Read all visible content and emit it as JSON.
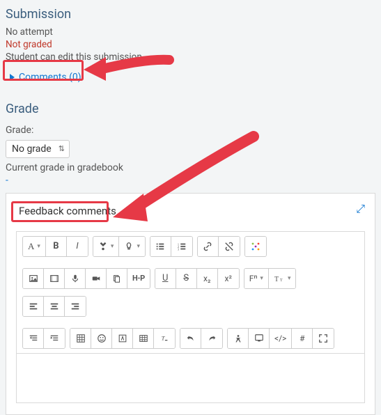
{
  "submission": {
    "heading": "Submission",
    "status_attempt": "No attempt",
    "status_graded": "Not graded",
    "status_edit": "Student can edit this submission",
    "comments_label": "Comments (0)"
  },
  "grade": {
    "heading": "Grade",
    "label": "Grade:",
    "selected": "No grade",
    "hint": "Current grade in gradebook",
    "dash": "-"
  },
  "feedback": {
    "title": "Feedback comments",
    "expand_icon": "⤢"
  },
  "toolbar": {
    "para": "A",
    "bold": "B",
    "italic": "I",
    "h5p": "H-P",
    "under": "U",
    "strike": "S",
    "sub": "x₂",
    "sup": "x²",
    "font": "Fⁿ",
    "align_l": "≡",
    "hash": "#",
    "code": "</>"
  },
  "icons": {
    "caret": "▾",
    "dd": "▾"
  }
}
